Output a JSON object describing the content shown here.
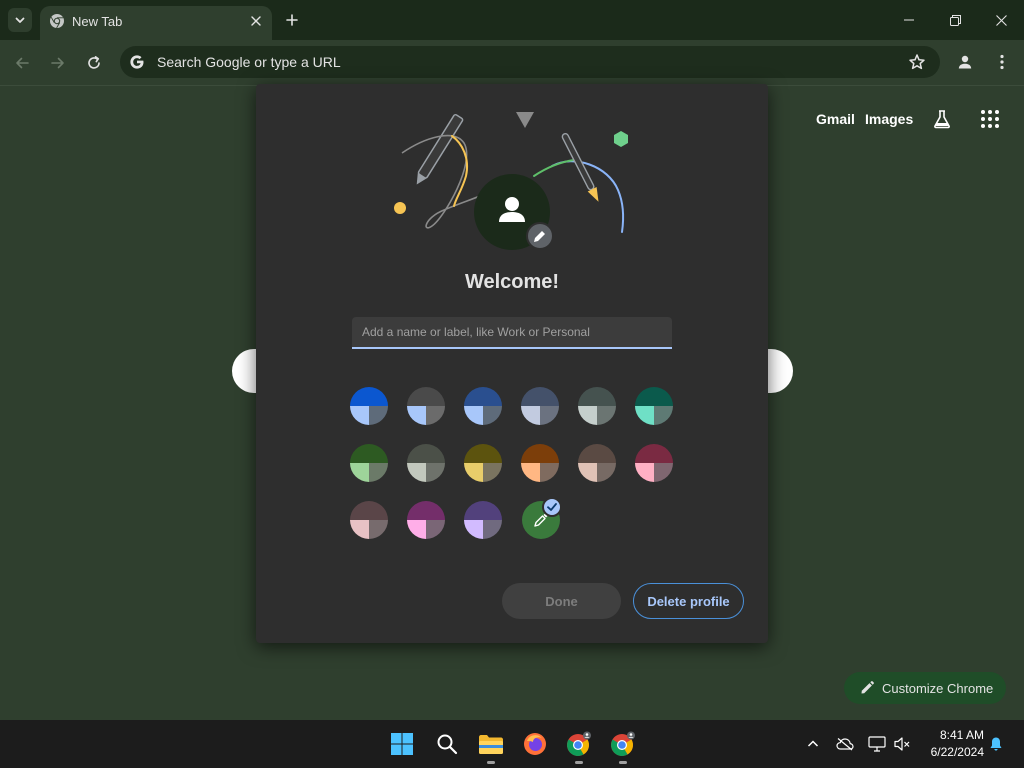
{
  "browser": {
    "tab_title": "New Tab",
    "omnibox_placeholder": "Search Google or type a URL"
  },
  "ntp": {
    "gmail_label": "Gmail",
    "images_label": "Images",
    "customize_label": "Customize Chrome"
  },
  "dialog": {
    "welcome": "Welcome!",
    "name_placeholder": "Add a name or label, like Work or Personal",
    "name_value": "",
    "done_label": "Done",
    "delete_label": "Delete profile",
    "selected_color": "custom",
    "color_options": [
      {
        "top": "#0b57d0",
        "left": "#a8c7fa",
        "right": "#5e6b7a"
      },
      {
        "top": "#4a4a4a",
        "left": "#a8c7fa",
        "right": "#6b6b6b"
      },
      {
        "top": "#2a4f8f",
        "left": "#a8c7fa",
        "right": "#5e6b7a"
      },
      {
        "top": "#44516a",
        "left": "#c2cbe0",
        "right": "#6b7280"
      },
      {
        "top": "#45524f",
        "left": "#c5cfcc",
        "right": "#6b7572"
      },
      {
        "top": "#0b5a4c",
        "left": "#6fe0c6",
        "right": "#5e7a74"
      },
      {
        "top": "#2d5a22",
        "left": "#9ed49a",
        "right": "#6b7a68"
      },
      {
        "top": "#4b5048",
        "left": "#c2c8bd",
        "right": "#6e726b"
      },
      {
        "top": "#5c530e",
        "left": "#e8cd6a",
        "right": "#7a7460"
      },
      {
        "top": "#7c3e0a",
        "left": "#ffb783",
        "right": "#7f6b5f"
      },
      {
        "top": "#5a4a43",
        "left": "#e0c2b6",
        "right": "#776a64"
      },
      {
        "top": "#7a2a42",
        "left": "#ffb0c4",
        "right": "#7f6670"
      },
      {
        "top": "#5a4548",
        "left": "#e8c2c5",
        "right": "#776b6d"
      },
      {
        "top": "#742e6a",
        "left": "#ffaee8",
        "right": "#7a6676"
      },
      {
        "top": "#52417c",
        "left": "#d2bbff",
        "right": "#706a7f"
      }
    ]
  },
  "taskbar": {
    "time": "8:41 AM",
    "date": "6/22/2024"
  }
}
